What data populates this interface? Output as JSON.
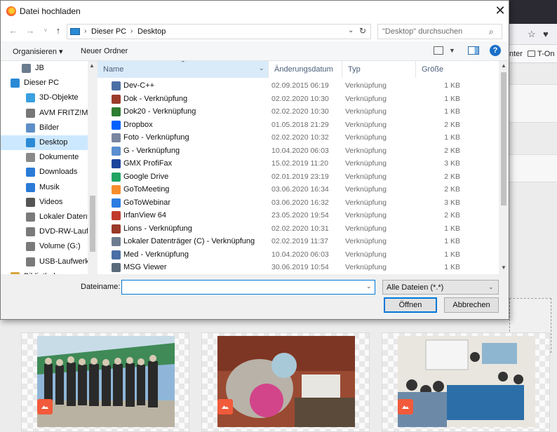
{
  "browser": {
    "bookmark_partial": "nter",
    "bookmark_folder": "T-On"
  },
  "dialog": {
    "title": "Datei hochladen",
    "close_glyph": "✕"
  },
  "address": {
    "crumbs": [
      "Dieser PC",
      "Desktop"
    ],
    "search_placeholder": "\"Desktop\" durchsuchen"
  },
  "commands": {
    "organize": "Organisieren ▾",
    "new_folder": "Neuer Ordner",
    "help": "?"
  },
  "tree": [
    {
      "label": "JB",
      "icon": "user-icon",
      "color": "#6b7c8e"
    },
    {
      "label": "Dieser PC",
      "icon": "computer-icon",
      "color": "#2a8ad6"
    },
    {
      "label": "3D-Objekte",
      "icon": "cube-icon",
      "color": "#3aa0e0"
    },
    {
      "label": "AVM FRITZ!Me",
      "icon": "device-icon",
      "color": "#777777"
    },
    {
      "label": "Bilder",
      "icon": "pictures-icon",
      "color": "#5f8fc7"
    },
    {
      "label": "Desktop",
      "icon": "desktop-icon",
      "color": "#2a8ad6",
      "selected": true
    },
    {
      "label": "Dokumente",
      "icon": "documents-icon",
      "color": "#8a8a8a"
    },
    {
      "label": "Downloads",
      "icon": "download-icon",
      "color": "#2a7bd6"
    },
    {
      "label": "Musik",
      "icon": "music-icon",
      "color": "#2a7bd6"
    },
    {
      "label": "Videos",
      "icon": "video-icon",
      "color": "#555555"
    },
    {
      "label": "Lokaler Datenträ",
      "icon": "drive-icon",
      "color": "#7a7a7a"
    },
    {
      "label": "DVD-RW-Laufw",
      "icon": "dvd-icon",
      "color": "#7a7a7a"
    },
    {
      "label": "Volume (G:)",
      "icon": "drive-icon",
      "color": "#7a7a7a"
    },
    {
      "label": "USB-Laufwerk",
      "icon": "usb-icon",
      "color": "#7a7a7a"
    },
    {
      "label": "Bibliotheken",
      "icon": "library-icon",
      "color": "#d9a640"
    }
  ],
  "columns": {
    "name": "Name",
    "date": "Änderungsdatum",
    "type": "Typ",
    "size": "Größe"
  },
  "files": [
    {
      "name": "Dev-C++",
      "date": "02.09.2015 06:19",
      "type": "Verknüpfung",
      "size": "1 KB",
      "icon": "devcpp-icon",
      "color": "#4a6fa5"
    },
    {
      "name": "Dok - Verknüpfung",
      "date": "02.02.2020 10:30",
      "type": "Verknüpfung",
      "size": "1 KB",
      "icon": "folder-shortcut-icon",
      "color": "#9c3b2a"
    },
    {
      "name": "Dok20 - Verknüpfung",
      "date": "02.02.2020 10:30",
      "type": "Verknüpfung",
      "size": "1 KB",
      "icon": "folder-shortcut-icon",
      "color": "#2e7d32"
    },
    {
      "name": "Dropbox",
      "date": "01.05.2018 21:29",
      "type": "Verknüpfung",
      "size": "2 KB",
      "icon": "dropbox-icon",
      "color": "#0061fe"
    },
    {
      "name": "Foto - Verknüpfung",
      "date": "02.02.2020 10:32",
      "type": "Verknüpfung",
      "size": "1 KB",
      "icon": "folder-shortcut-icon",
      "color": "#7a86a0"
    },
    {
      "name": "G - Verknüpfung",
      "date": "10.04.2020 06:03",
      "type": "Verknüpfung",
      "size": "2 KB",
      "icon": "drive-shortcut-icon",
      "color": "#5b8fd0"
    },
    {
      "name": "GMX ProfiFax",
      "date": "15.02.2019 11:20",
      "type": "Verknüpfung",
      "size": "3 KB",
      "icon": "fax-icon",
      "color": "#1c449b"
    },
    {
      "name": "Google Drive",
      "date": "02.01.2019 23:19",
      "type": "Verknüpfung",
      "size": "2 KB",
      "icon": "google-drive-icon",
      "color": "#1fa463"
    },
    {
      "name": "GoToMeeting",
      "date": "03.06.2020 16:34",
      "type": "Verknüpfung",
      "size": "2 KB",
      "icon": "gotomeeting-icon",
      "color": "#f68d2e"
    },
    {
      "name": "GoToWebinar",
      "date": "03.06.2020 16:32",
      "type": "Verknüpfung",
      "size": "3 KB",
      "icon": "gotowebinar-icon",
      "color": "#2b7de1"
    },
    {
      "name": "IrfanView 64",
      "date": "23.05.2020 19:54",
      "type": "Verknüpfung",
      "size": "2 KB",
      "icon": "irfanview-icon",
      "color": "#c0392b"
    },
    {
      "name": "Lions - Verknüpfung",
      "date": "02.02.2020 10:31",
      "type": "Verknüpfung",
      "size": "1 KB",
      "icon": "folder-shortcut-icon",
      "color": "#9a3a2a"
    },
    {
      "name": "Lokaler Datenträger (C) - Verknüpfung",
      "date": "02.02.2019 11:37",
      "type": "Verknüpfung",
      "size": "1 KB",
      "icon": "drive-shortcut-icon",
      "color": "#6d7d8f"
    },
    {
      "name": "Med - Verknüpfung",
      "date": "10.04.2020 06:03",
      "type": "Verknüpfung",
      "size": "1 KB",
      "icon": "folder-shortcut-icon",
      "color": "#4a6fa5"
    },
    {
      "name": "MSG Viewer",
      "date": "30.06.2019 10:54",
      "type": "Verknüpfung",
      "size": "1 KB",
      "icon": "msg-viewer-icon",
      "color": "#5a6a7a"
    }
  ],
  "bottom": {
    "filename_label": "Dateiname:",
    "filename_value": "",
    "filter": "Alle Dateien (*.*)",
    "open": "Öffnen",
    "cancel": "Abbrechen"
  }
}
